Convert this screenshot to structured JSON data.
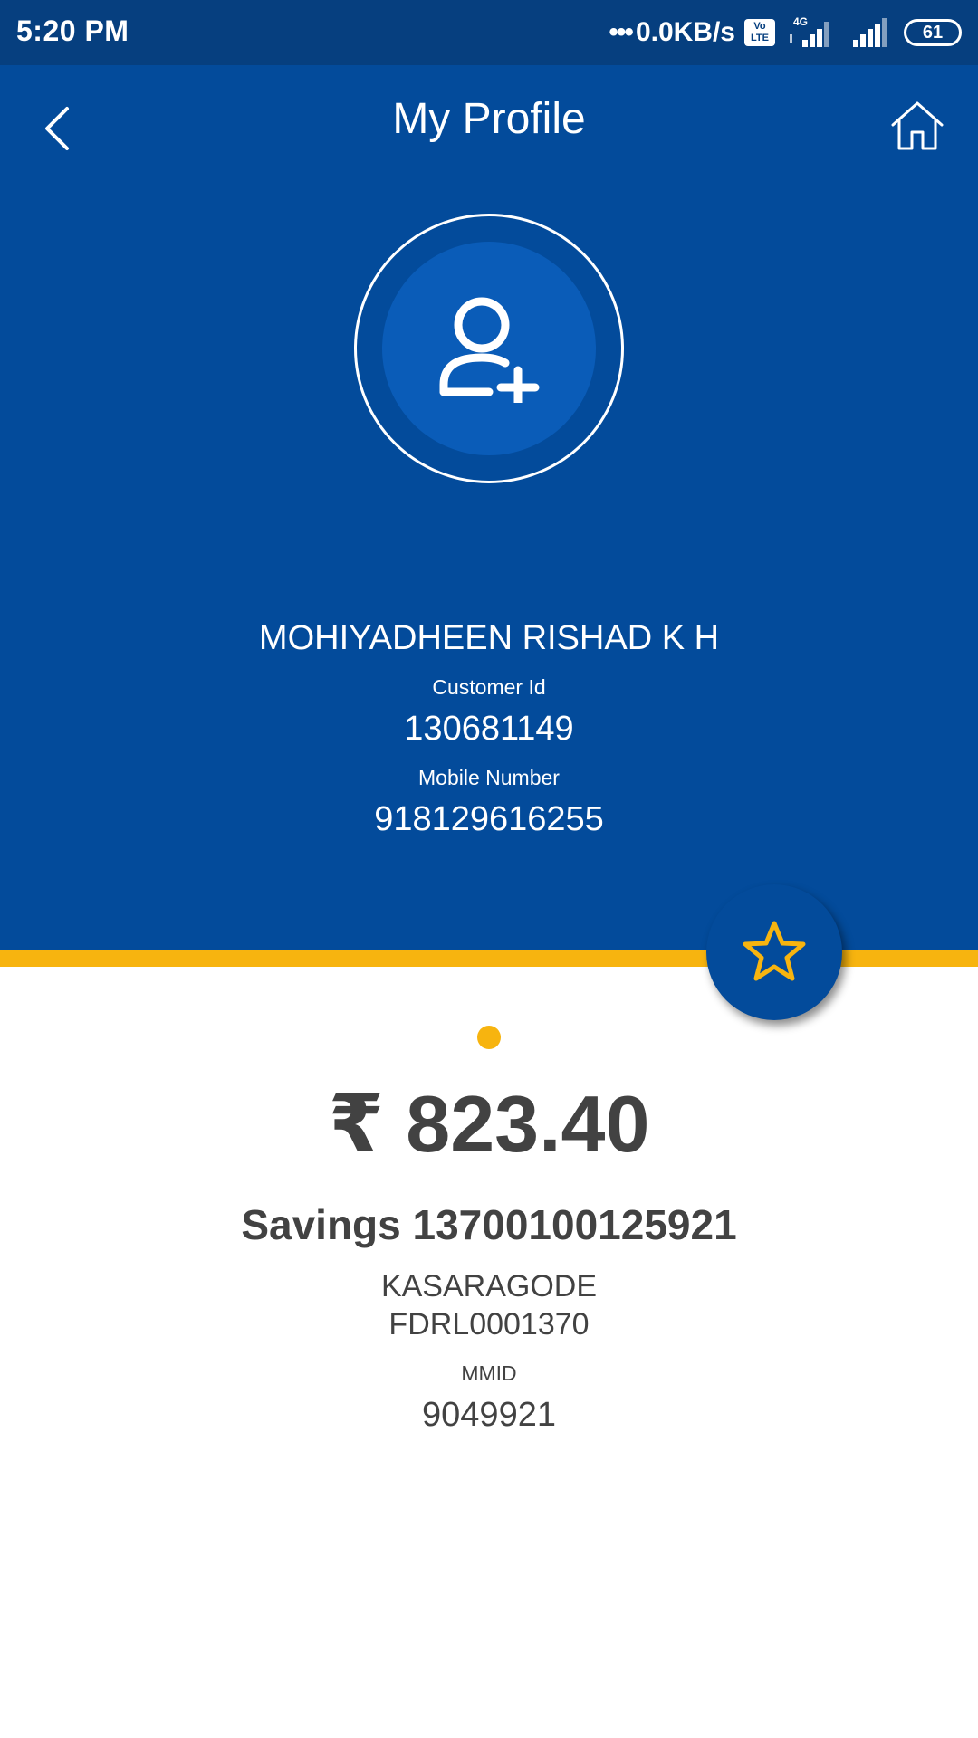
{
  "status_bar": {
    "time": "5:20 PM",
    "network_speed": "0.0KB/s",
    "volte": "Vo LTE",
    "network_type": "4G",
    "battery": "61"
  },
  "header": {
    "title": "My Profile",
    "back_icon": "chevron-left-icon",
    "home_icon": "home-icon"
  },
  "profile": {
    "avatar_icon": "add-user-icon",
    "name": "MOHIYADHEEN RISHAD K H",
    "customer_id_label": "Customer Id",
    "customer_id": "130681149",
    "mobile_label": "Mobile Number",
    "mobile_number": "918129616255"
  },
  "account": {
    "favorite_icon": "star-icon",
    "balance": "₹ 823.40",
    "title": "Savings 13700100125921",
    "branch": "KASARAGODE",
    "ifsc": "FDRL0001370",
    "mmid_label": "MMID",
    "mmid": "9049921"
  },
  "colors": {
    "primary": "#034b9b",
    "status_bar": "#063f7f",
    "accent": "#f7b40f",
    "text_dark": "#424242"
  }
}
